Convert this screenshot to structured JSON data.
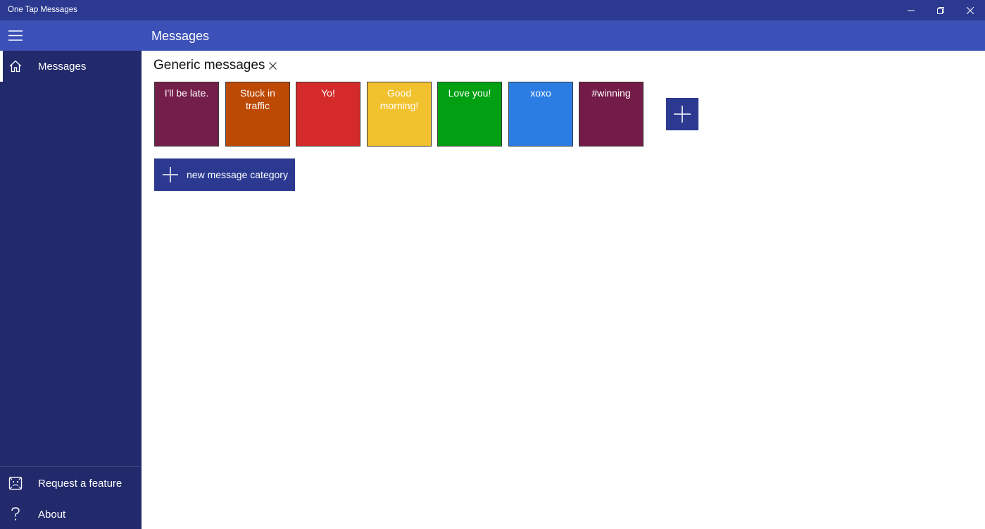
{
  "window": {
    "title": "One Tap Messages"
  },
  "header": {
    "title": "Messages",
    "menu_icon": "hamburger-icon"
  },
  "sidebar": {
    "items": [
      {
        "label": "Messages",
        "icon": "home-icon",
        "selected": true
      },
      {
        "label": "Request a feature",
        "icon": "feedback-icon",
        "selected": false
      },
      {
        "label": "About",
        "icon": "question-icon",
        "selected": false
      }
    ]
  },
  "main": {
    "category": {
      "title": "Generic messages",
      "close_icon": "close-icon"
    },
    "tiles": [
      {
        "text": "I'll be late.",
        "color": "#741e4a"
      },
      {
        "text": "Stuck in traffic",
        "color": "#bd4a04"
      },
      {
        "text": "Yo!",
        "color": "#d42a2a"
      },
      {
        "text": "Good morning!",
        "color": "#f2c12e"
      },
      {
        "text": "Love you!",
        "color": "#00a012"
      },
      {
        "text": "xoxo",
        "color": "#2b7de3"
      },
      {
        "text": "#winning",
        "color": "#741c48"
      }
    ],
    "add_tile_icon": "plus-icon",
    "new_category_button": "new message category"
  },
  "colors": {
    "titlebar": "#2b3990",
    "header": "#3c51b8",
    "sidebar": "#222a6b",
    "accent": "#2b3990"
  }
}
